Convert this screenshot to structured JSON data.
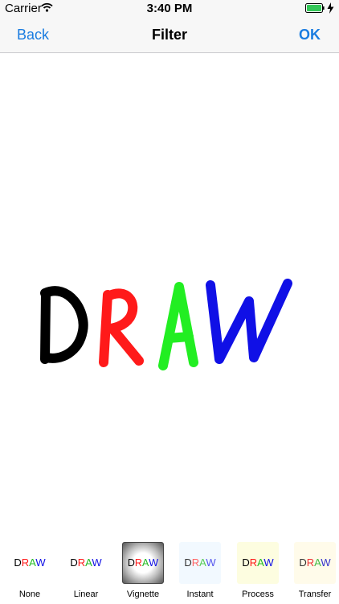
{
  "status": {
    "carrier": "Carrier",
    "time": "3:40 PM"
  },
  "nav": {
    "back_label": "Back",
    "title": "Filter",
    "ok_label": "OK"
  },
  "canvas": {
    "text": "DRAW",
    "letter_colors": [
      "#000000",
      "#ff1a1a",
      "#22ee22",
      "#1010e6"
    ]
  },
  "filters": [
    {
      "label": "None",
      "bg": "#ffffff"
    },
    {
      "label": "Linear",
      "bg": "#ffffff"
    },
    {
      "label": "Vignette",
      "bg": "vignette"
    },
    {
      "label": "Instant",
      "bg": "#f2f9ff"
    },
    {
      "label": "Process",
      "bg": "#fdfde0"
    },
    {
      "label": "Transfer",
      "bg": "#fffbea"
    }
  ],
  "colors": {
    "accent": "#1a7ce0",
    "battery": "#34c759"
  }
}
